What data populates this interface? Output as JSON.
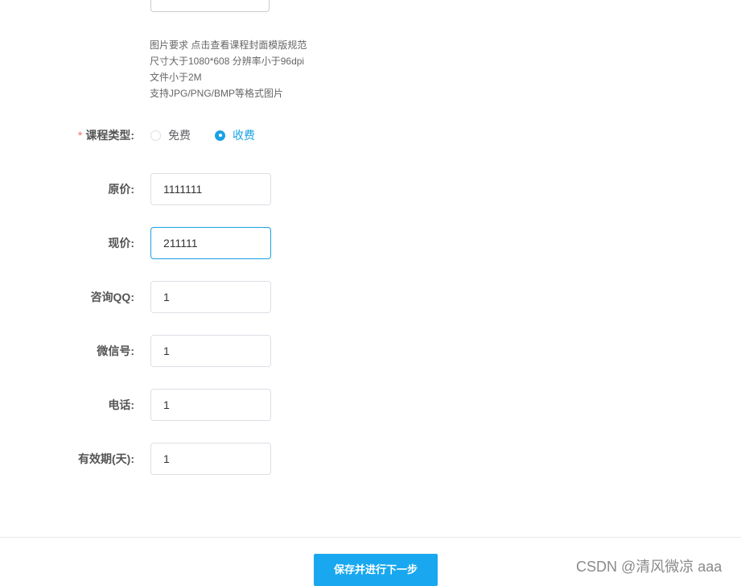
{
  "cover_requirements": [
    "图片要求 点击查看课程封面模版规范",
    "尺寸大于1080*608 分辨率小于96dpi",
    "文件小于2M",
    "支持JPG/PNG/BMP等格式图片"
  ],
  "course_type": {
    "required_mark": "*",
    "label": "课程类型:",
    "options": [
      {
        "label": "免费",
        "checked": false
      },
      {
        "label": "收费",
        "checked": true
      }
    ]
  },
  "fields": {
    "original_price": {
      "label": "原价:",
      "value": "1111111"
    },
    "current_price": {
      "label": "现价:",
      "value": "211111"
    },
    "qq": {
      "label": "咨询QQ:",
      "value": "1"
    },
    "wechat": {
      "label": "微信号:",
      "value": "1"
    },
    "phone": {
      "label": "电话:",
      "value": "1"
    },
    "validity": {
      "label": "有效期(天):",
      "value": "1"
    }
  },
  "submit_label": "保存并进行下一步",
  "watermark": "CSDN @清风微凉 aaa",
  "colors": {
    "accent": "#19a2e3",
    "button": "#19a8f0",
    "required": "#f56c6c"
  }
}
